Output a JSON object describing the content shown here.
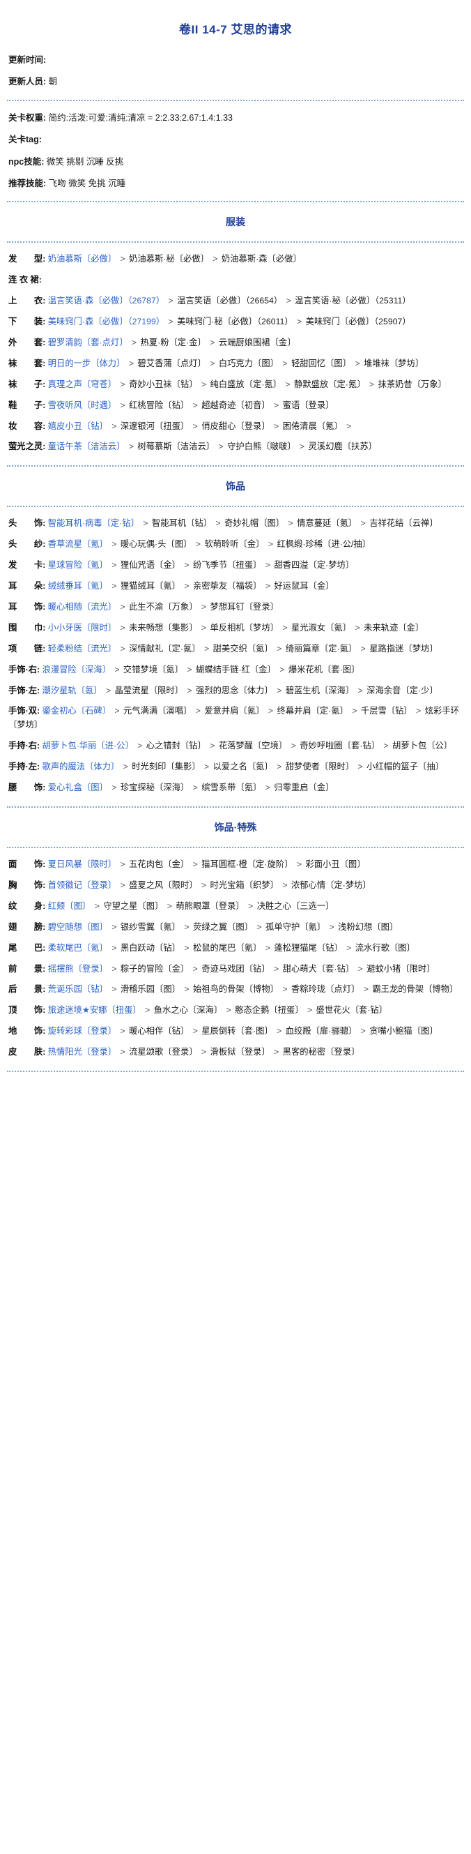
{
  "title": "卷II 14-7 艾思的请求",
  "meta": [
    {
      "label": "更新时间:",
      "value": ""
    },
    {
      "label": "更新人员:",
      "value": "朝"
    }
  ],
  "meta2": [
    {
      "label": "关卡权重:",
      "value": "简约:活泼:可爱:清纯:清凉 = 2:2.33:2.67:1.4:1.33"
    },
    {
      "label": "关卡tag:",
      "value": ""
    },
    {
      "label": "npc技能:",
      "value": "微笑 挑剔 沉睡 反挑"
    },
    {
      "label": "推荐技能:",
      "value": "飞吻 微笑 免挑 沉睡"
    }
  ],
  "sections": [
    {
      "heading": "服装",
      "rows": [
        {
          "label": "发　　型:",
          "items": [
            "奶油慕斯〔必做〕",
            "奶油慕斯·秘〔必做〕",
            "奶油慕斯·森〔必做〕"
          ]
        },
        {
          "label": "连 衣 裙:",
          "items": []
        },
        {
          "label": "上　　衣:",
          "items": [
            "温言笑语·森〔必做〕（26787）",
            "温言笑语〔必做〕（26654）",
            "温言笑语·秘〔必做〕（25311）"
          ]
        },
        {
          "label": "下　　装:",
          "items": [
            "美味窍门·森〔必做〕（27199）",
            "美味窍门·秘〔必做〕（26011）",
            "美味窍门〔必做〕（25907）"
          ]
        },
        {
          "label": "外　　套:",
          "items": [
            "碧罗清韵〔套·点灯〕",
            "热夏·粉〔定·金〕",
            "云端厨娘围裙〔金〕"
          ]
        },
        {
          "label": "袜　　套:",
          "items": [
            "明日的一步〔体力〕",
            "碧艾香蒲〔点灯〕",
            "白巧克力〔图〕",
            "轻甜回忆〔图〕",
            "堆堆袜〔梦坊〕"
          ]
        },
        {
          "label": "袜　　子:",
          "items": [
            "真理之声〔穹苍〕",
            "奇妙小丑袜〔钻〕",
            "纯白盛放〔定·氪〕",
            "静默盛放〔定·氪〕",
            "抹茶奶昔〔万象〕"
          ]
        },
        {
          "label": "鞋　　子:",
          "items": [
            "雪夜听风〔时遇〕",
            "红桃冒险〔钻〕",
            "超越奇迹〔初音〕",
            "蜜语〔登录〕"
          ]
        },
        {
          "label": "妆　　容:",
          "items": [
            "嬉皮小丑〔钻〕",
            "深邃银河〔扭蛋〕",
            "俏皮甜心〔登录〕",
            "困倦清晨〔氪〕",
            ""
          ]
        },
        {
          "label": "萤光之灵:",
          "items": [
            "童话午茶〔洁洁云〕",
            "树莓慕斯〔洁洁云〕",
            "守护白熊〔啵啵〕",
            "灵溪幻鹿〔扶苏〕"
          ]
        }
      ]
    },
    {
      "heading": "饰品",
      "rows": [
        {
          "label": "头　　饰:",
          "items": [
            "智能耳机·病毒〔定·钻〕",
            "智能耳机〔钻〕",
            "奇妙礼帽〔图〕",
            "情意蔓延〔氪〕",
            "吉祥花结〔云禅〕"
          ]
        },
        {
          "label": "头　　纱:",
          "items": [
            "香草流星〔氪〕",
            "暖心玩偶·头〔图〕",
            "软萌聆听〔金〕",
            "红枫缎·珍稀〔进·公/抽〕"
          ]
        },
        {
          "label": "发　　卡:",
          "items": [
            "星球冒险〔氪〕",
            "狸仙咒语〔金〕",
            "纷飞季节〔扭蛋〕",
            "甜香四溢〔定·梦坊〕"
          ]
        },
        {
          "label": "耳　　朵:",
          "items": [
            "绒绒垂耳〔氪〕",
            "狸猫绒耳〔氪〕",
            "亲密挚友〔福袋〕",
            "好运鼠耳〔金〕"
          ]
        },
        {
          "label": "耳　　饰:",
          "items": [
            "暖心相随〔流光〕",
            "此生不渝〔万象〕",
            "梦想耳钉〔登录〕"
          ]
        },
        {
          "label": "围　　巾:",
          "items": [
            "小小牙医〔限时〕",
            "未来畅想〔集影〕",
            "单反相机〔梦坊〕",
            "星光淑女〔氪〕",
            "未来轨迹〔金〕"
          ]
        },
        {
          "label": "项　　链:",
          "items": [
            "轻柔粉结〔流光〕",
            "深情献礼〔定·氪〕",
            "甜美交织〔氪〕",
            "绮丽篇章〔定·氪〕",
            "星路指迷〔梦坊〕"
          ]
        },
        {
          "label": "手饰·右:",
          "items": [
            "浪漫冒险〔深海〕",
            "交错梦境〔氪〕",
            "蝴蝶结手链·红〔金〕",
            "爆米花机〔套·图〕"
          ]
        },
        {
          "label": "手饰·左:",
          "items": [
            "潮汐星轨〔氪〕",
            "晶莹流星〔限时〕",
            "强烈的思念〔体力〕",
            "碧蓝生机〔深海〕",
            "深海余音〔定·少〕"
          ]
        },
        {
          "label": "手饰·双:",
          "items": [
            "鎏金初心〔石碑〕",
            "元气满满〔演唱〕",
            "爱意并肩〔氪〕",
            "终幕并肩〔定·氪〕",
            "千层雪〔钻〕",
            "炫彩手环〔梦坊〕"
          ]
        },
        {
          "label": "手持·右:",
          "items": [
            "胡萝卜包·华丽〔进·公〕",
            "心之错封〔钻〕",
            "花落梦醒〔空境〕",
            "奇妙呼啦圈〔套·钻〕",
            "胡萝卜包〔公〕"
          ]
        },
        {
          "label": "手持·左:",
          "items": [
            "歌声的魔法〔体力〕",
            "时光刻印〔集影〕",
            "以爱之名〔氪〕",
            "甜梦使者〔限时〕",
            "小红帽的篮子〔抽〕"
          ]
        },
        {
          "label": "腰　　饰:",
          "items": [
            "爱心礼盒〔图〕",
            "珍宝探秘〔深海〕",
            "缤雪系带〔氪〕",
            "归零重启〔金〕"
          ]
        }
      ]
    },
    {
      "heading": "饰品·特殊",
      "rows": [
        {
          "label": "面　　饰:",
          "items": [
            "夏日风暴〔限时〕",
            "五花肉包〔金〕",
            "猫耳圆框·橙〔定·旋阶〕",
            "彩面小丑〔图〕"
          ]
        },
        {
          "label": "胸　　饰:",
          "items": [
            "首领徽记〔登录〕",
            "盛夏之风〔限时〕",
            "时光宝箱〔织梦〕",
            "浓郁心情〔定·梦坊〕"
          ]
        },
        {
          "label": "纹　　身:",
          "items": [
            "红颊〔图〕",
            "守望之星〔图〕",
            "萌熊眼罩〔登录〕",
            "决胜之心〔三选一〕"
          ]
        },
        {
          "label": "翅　　膀:",
          "items": [
            "碧空随想〔图〕",
            "银纱雪翼〔氪〕",
            "荧绿之翼〔图〕",
            "孤单守护〔氪〕",
            "浅粉幻想〔图〕"
          ]
        },
        {
          "label": "尾　　巴:",
          "items": [
            "柔软尾巴〔氪〕",
            "黑白跃动〔钻〕",
            "松鼠的尾巴〔氪〕",
            "蓬松狸猫尾〔钻〕",
            "流水行歌〔图〕"
          ]
        },
        {
          "label": "前　　景:",
          "items": [
            "摇摆熊〔登录〕",
            "粽子的冒险〔金〕",
            "奇迹马戏团〔钻〕",
            "甜心萌犬〔套·钻〕",
            "避蚊小猪〔限时〕"
          ]
        },
        {
          "label": "后　　景:",
          "items": [
            "荒诞乐园〔钻〕",
            "滑稽乐园〔图〕",
            "始祖鸟的骨架〔博物〕",
            "香粽玲珑〔点灯〕",
            "霸王龙的骨架〔博物〕"
          ]
        },
        {
          "label": "顶　　饰:",
          "items": [
            "旅途迷境★安娜〔扭蛋〕",
            "鱼水之心〔深海〕",
            "憨态企鹅〔扭蛋〕",
            "盛世花火〔套·钻〕"
          ]
        },
        {
          "label": "地　　饰:",
          "items": [
            "旋转彩球〔登录〕",
            "暖心相伴〔钻〕",
            "星辰倒转〔套·图〕",
            "血绞殿〔扉·骊骢〕",
            "贪嘴小鲍猫〔图〕"
          ]
        },
        {
          "label": "皮　　肤:",
          "items": [
            "热情阳光〔登录〕",
            "流星颂歌〔登录〕",
            "滑板狱〔登录〕",
            "黑客的秘密〔登录〕"
          ]
        }
      ]
    }
  ],
  "colors": {
    "title": "#1f3f94",
    "first_item": "#2a62c6",
    "divider": "#7fa8c9"
  }
}
